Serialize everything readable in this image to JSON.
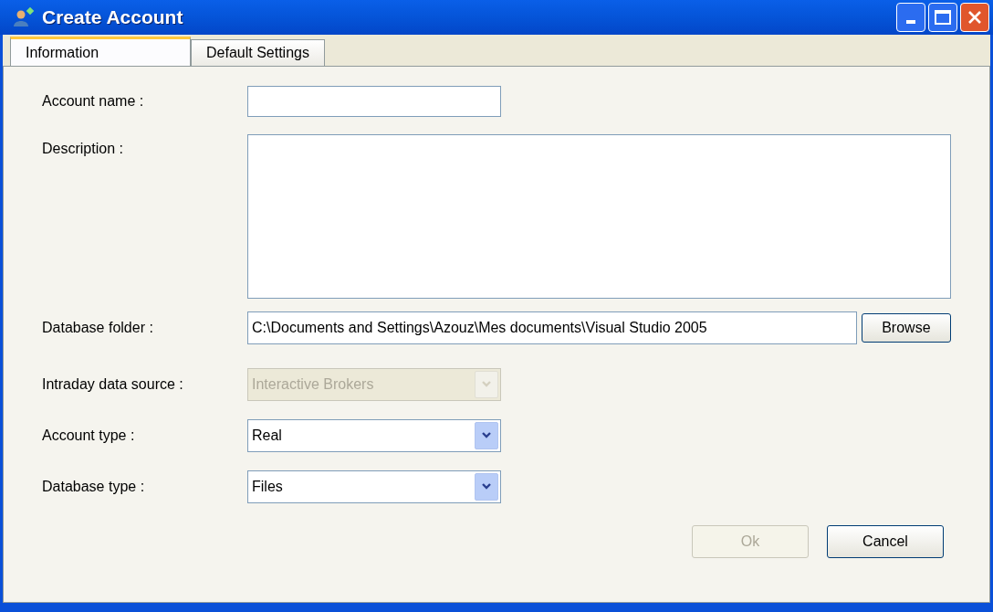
{
  "window": {
    "title": "Create Account"
  },
  "tabs": [
    {
      "label": "Information",
      "selected": true
    },
    {
      "label": "Default Settings",
      "selected": false
    }
  ],
  "fields": [
    {
      "kind": "text",
      "label": "Account name :"
    },
    {
      "kind": "textarea",
      "label": "Description :"
    },
    {
      "kind": "folder",
      "label": "Database folder :",
      "value": "C:\\Documents and Settings\\Azouz\\Mes documents\\Visual Studio 2005",
      "button": "Browse"
    },
    {
      "kind": "combo",
      "label": "Intraday data source :",
      "value": "Interactive Brokers",
      "disabled": true
    },
    {
      "kind": "combo",
      "label": "Account type :",
      "value": "Real",
      "disabled": false
    },
    {
      "kind": "combo",
      "label": "Database type :",
      "value": "Files",
      "disabled": false
    }
  ],
  "buttons": [
    {
      "label": "Ok",
      "disabled": true
    },
    {
      "label": "Cancel",
      "disabled": false
    }
  ]
}
